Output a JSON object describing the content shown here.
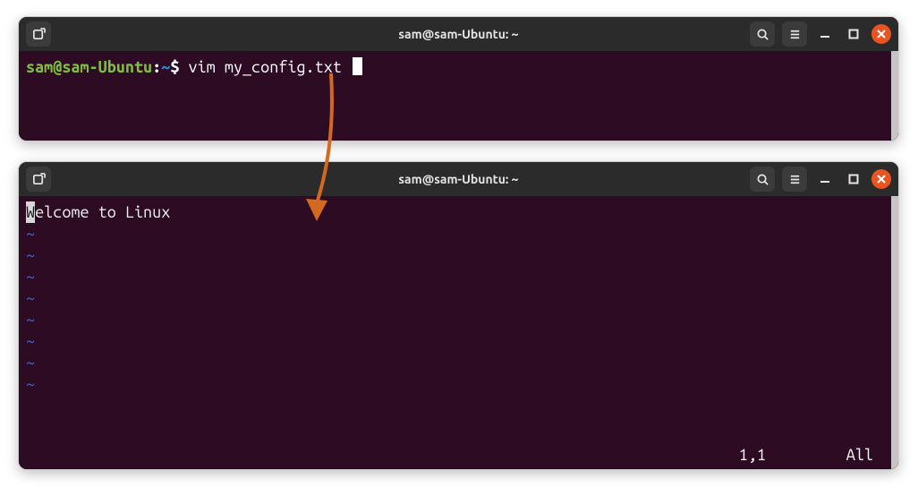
{
  "colors": {
    "terminal_bg": "#2d0b22",
    "titlebar_bg": "#2b2b2b",
    "prompt_user": "#7fbf41",
    "prompt_path": "#3d7cc9",
    "close_btn": "#e95420",
    "tilde": "#4a6bd6",
    "arrow": "#d3691e"
  },
  "window1": {
    "title": "sam@sam-Ubuntu: ~",
    "prompt": {
      "user_host": "sam@sam-Ubuntu",
      "separator": ":",
      "path": "~",
      "symbol": "$"
    },
    "command": "vim my_config.txt"
  },
  "window2": {
    "title": "sam@sam-Ubuntu: ~",
    "file_first_char": "W",
    "file_rest": "elcome to Linux",
    "tilde": "~",
    "tilde_count": 8,
    "status": {
      "position": "1,1",
      "scroll": "All"
    }
  }
}
